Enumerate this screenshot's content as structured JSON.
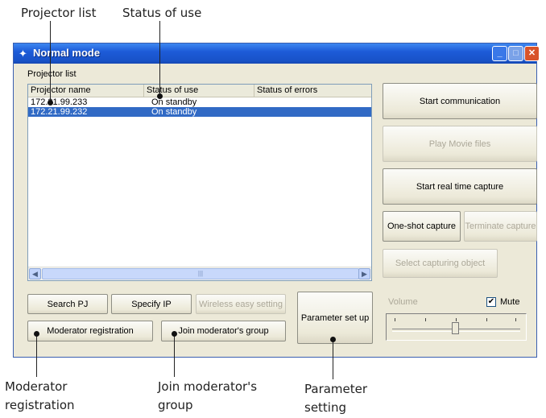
{
  "callouts": {
    "projector_list": "Projector list",
    "status_of_use": "Status of use",
    "moderator_registration_1": "Moderator",
    "moderator_registration_2": "registration",
    "join_group_1": "Join moderator's",
    "join_group_2": "group",
    "parameter_setting_1": "Parameter",
    "parameter_setting_2": "setting"
  },
  "window": {
    "title": "Normal mode",
    "minimize": "_",
    "maximize": "□",
    "close": "✕"
  },
  "projector_list": {
    "label": "Projector list",
    "columns": [
      "Projector name",
      "Status of use",
      "Status of errors"
    ],
    "rows": [
      {
        "name": "172.21.99.233",
        "status": "On standby",
        "errors": ""
      },
      {
        "name": "172.21.99.232",
        "status": "On standby",
        "errors": ""
      }
    ],
    "selected_row": 1
  },
  "buttons": {
    "search_pj": "Search PJ",
    "specify_ip": "Specify IP",
    "wireless_easy_setting": "Wireless easy setting",
    "moderator_registration": "Moderator registration",
    "join_moderators_group": "Join moderator's group",
    "parameter_set_up": "Parameter set up",
    "start_communication": "Start communication",
    "play_movie_files": "Play Movie files",
    "start_real_time_capture": "Start real time capture",
    "one_shot_capture": "One-shot capture",
    "terminate_capture": "Terminate capture",
    "select_capturing_object": "Select capturing object"
  },
  "volume": {
    "label": "Volume",
    "mute_label": "Mute",
    "mute_checked": true,
    "level": 0.5
  },
  "icons": {
    "app": "app-icon",
    "scroll_left": "scroll-left-arrow-icon",
    "scroll_right": "scroll-right-arrow-icon"
  }
}
